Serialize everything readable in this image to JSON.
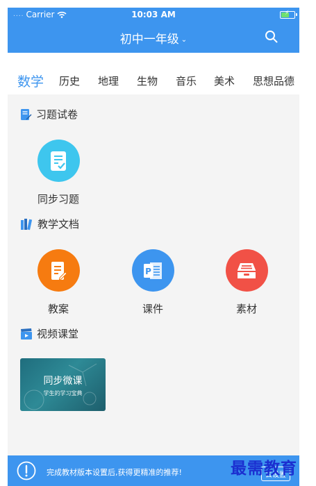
{
  "status": {
    "carrier_dots": "....",
    "carrier": "Carrier",
    "time": "10:03 AM",
    "battery_level": 0.6
  },
  "nav": {
    "title": "初中一年级",
    "chevron": "⌄"
  },
  "subjects": [
    "数学",
    "历史",
    "地理",
    "生物",
    "音乐",
    "美术",
    "思想品德"
  ],
  "active_subject": "数学",
  "sections": {
    "exercises": {
      "title": "习题试卷",
      "items": [
        {
          "label": "同步习题",
          "icon": "checklist-icon",
          "color": "#3ec6ee"
        }
      ]
    },
    "documents": {
      "title": "教学文档",
      "items": [
        {
          "label": "教案",
          "icon": "lesson-plan-icon",
          "color": "#f67b10"
        },
        {
          "label": "课件",
          "icon": "powerpoint-icon",
          "color": "#3d95ef"
        },
        {
          "label": "素材",
          "icon": "archive-box-icon",
          "color": "#f15146"
        }
      ]
    },
    "videos": {
      "title": "视频课堂",
      "card": {
        "title": "同步微课",
        "subtitle": "学生的学习宝典"
      }
    }
  },
  "banner": {
    "text": "完成教材版本设置后,获得更精准的推荐!",
    "button": "去设置"
  },
  "watermark": "最需教育",
  "colors": {
    "primary": "#3d95ef",
    "background": "#f4f4f4"
  }
}
